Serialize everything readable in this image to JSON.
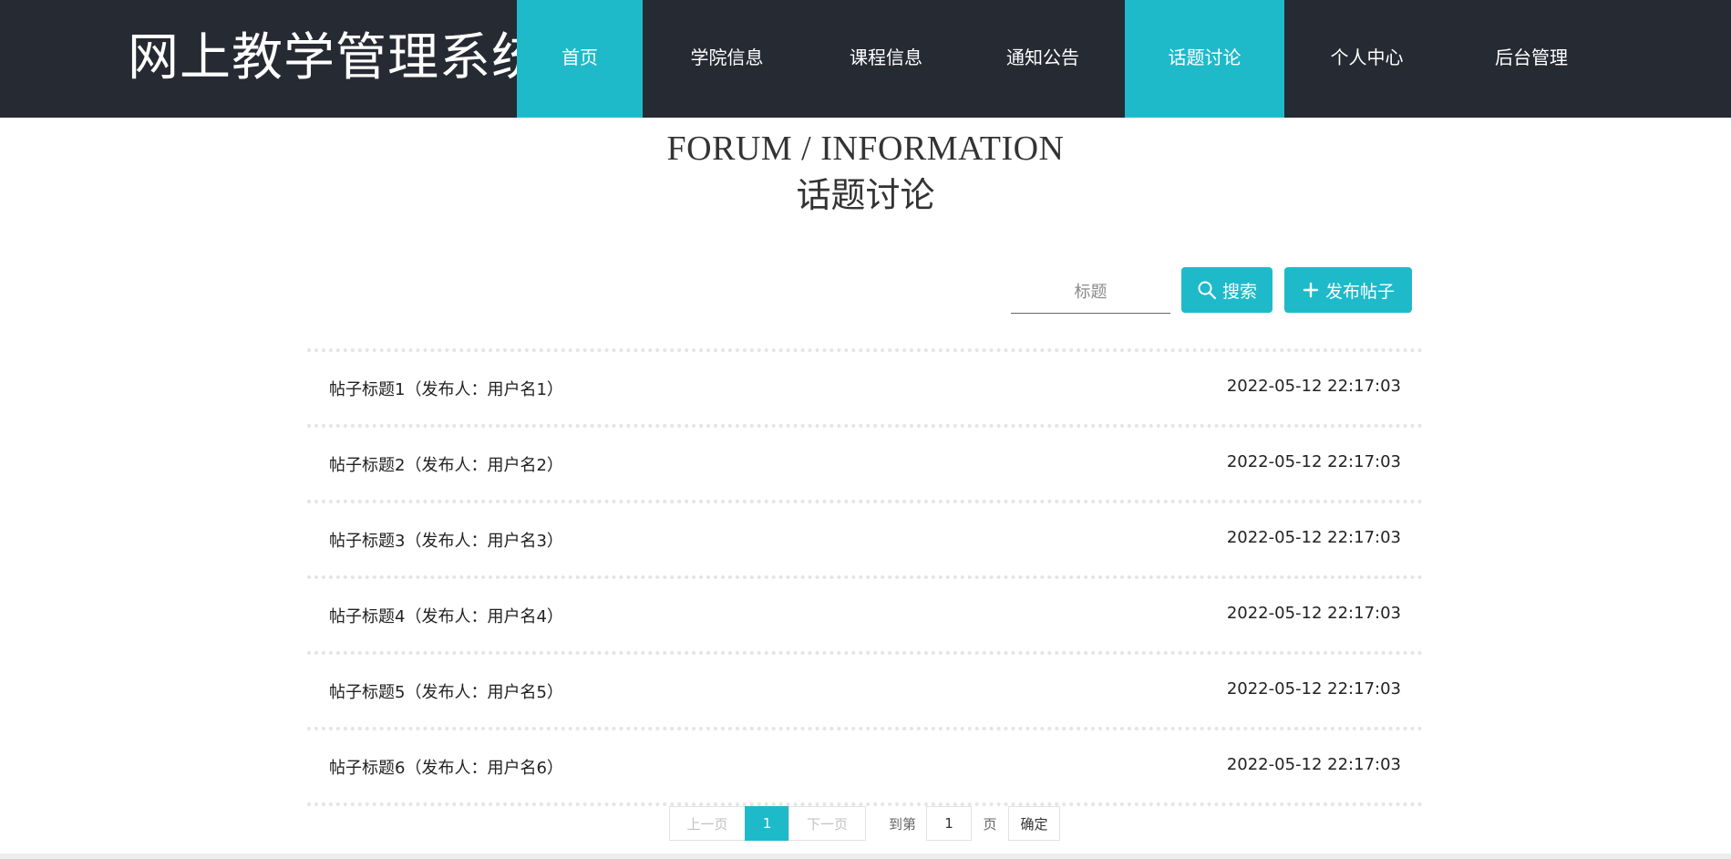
{
  "header": {
    "brand": "网上教学管理系统",
    "nav": [
      {
        "label": "首页",
        "active": true
      },
      {
        "label": "学院信息",
        "active": false
      },
      {
        "label": "课程信息",
        "active": false
      },
      {
        "label": "通知公告",
        "active": false
      },
      {
        "label": "话题讨论",
        "active": true
      },
      {
        "label": "个人中心",
        "active": false
      },
      {
        "label": "后台管理",
        "active": false
      }
    ]
  },
  "page": {
    "title_en": "FORUM / INFORMATION",
    "title_cn": "话题讨论"
  },
  "search": {
    "placeholder": "标题",
    "search_label": "搜索",
    "post_label": "发布帖子",
    "search_icon": "search-icon",
    "plus_icon": "plus-icon"
  },
  "posts": [
    {
      "title": "帖子标题1（发布人：用户名1）",
      "time": "2022-05-12 22:17:03"
    },
    {
      "title": "帖子标题2（发布人：用户名2）",
      "time": "2022-05-12 22:17:03"
    },
    {
      "title": "帖子标题3（发布人：用户名3）",
      "time": "2022-05-12 22:17:03"
    },
    {
      "title": "帖子标题4（发布人：用户名4）",
      "time": "2022-05-12 22:17:03"
    },
    {
      "title": "帖子标题5（发布人：用户名5）",
      "time": "2022-05-12 22:17:03"
    },
    {
      "title": "帖子标题6（发布人：用户名6）",
      "time": "2022-05-12 22:17:03"
    }
  ],
  "pagination": {
    "prev": "上一页",
    "current": "1",
    "next": "下一页",
    "goto_label": "到第",
    "page_value": "1",
    "page_unit": "页",
    "confirm": "确定"
  },
  "colors": {
    "header_bg": "#262a33",
    "accent": "#1fbaca"
  }
}
